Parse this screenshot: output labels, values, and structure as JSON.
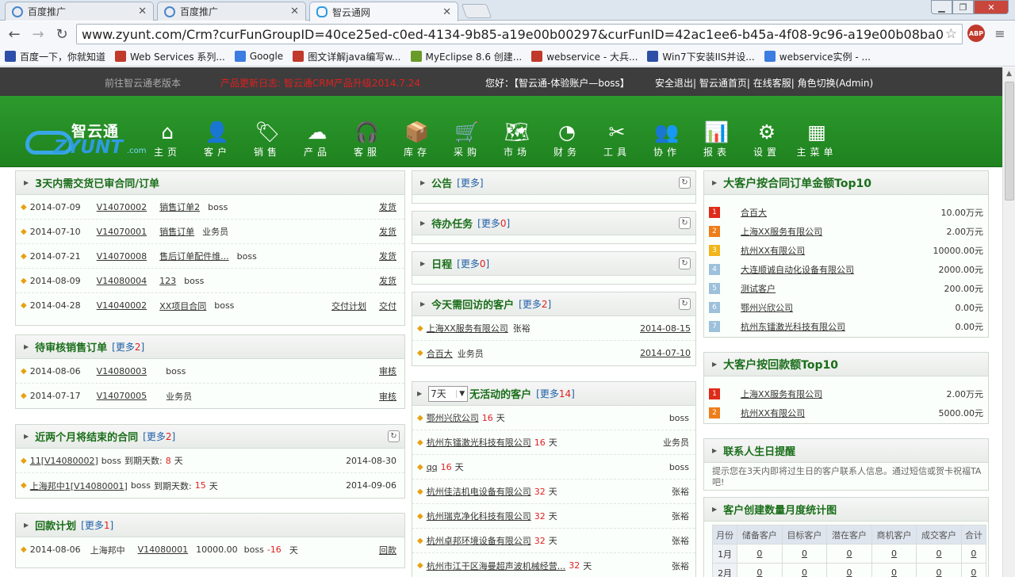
{
  "browser": {
    "tabs": [
      {
        "title": "百度推广",
        "active": false
      },
      {
        "title": "百度推广",
        "active": false
      },
      {
        "title": "智云通网",
        "active": true
      }
    ],
    "url": "www.zyunt.com/Crm?curFunGroupID=40ce25ed-c0ed-4134-9b85-a19e00b00297&curFunID=42ac1ee6-b45a-4f08-9c96-a19e00b08ba0",
    "abp_label": "ABP",
    "bookmarks": [
      {
        "label": "百度一下，你就知道",
        "color": "#2d4fa8"
      },
      {
        "label": "Web Services 系列...",
        "color": "#c0392b"
      },
      {
        "label": "Google",
        "color": "#3b7de0"
      },
      {
        "label": "图文详解java编写w...",
        "color": "#c0392b"
      },
      {
        "label": "MyEclipse 8.6 创建...",
        "color": "#6a9a2a"
      },
      {
        "label": "webservice - 大兵...",
        "color": "#c0392b"
      },
      {
        "label": "Win7下安装IIS并设...",
        "color": "#2d4fa8"
      },
      {
        "label": "webservice实例 - ...",
        "color": "#3b7de0"
      }
    ]
  },
  "topbar": {
    "old_version": "前往智云通老版本",
    "notice": "产品更新日志: 智云通CRM产品升级2014.7.24",
    "hello": "您好：【智云通-体验账户—boss】",
    "links": "安全退出| 智云通首页| 在线客服| 角色切换(Admin)"
  },
  "logo": {
    "zh": "智云通",
    "en": "ZYUNT",
    "com": ".com"
  },
  "menu": [
    {
      "icon": "⌂",
      "label": "主页"
    },
    {
      "icon": "👤",
      "label": "客户"
    },
    {
      "icon": "🏷",
      "label": "销售"
    },
    {
      "icon": "☁",
      "label": "产品"
    },
    {
      "icon": "🎧",
      "label": "客服"
    },
    {
      "icon": "📦",
      "label": "库存"
    },
    {
      "icon": "🛒",
      "label": "采购"
    },
    {
      "icon": "🗺",
      "label": "市场"
    },
    {
      "icon": "◔",
      "label": "财务"
    },
    {
      "icon": "✂",
      "label": "工具"
    },
    {
      "icon": "👥",
      "label": "协作"
    },
    {
      "icon": "📊",
      "label": "报表"
    },
    {
      "icon": "⚙",
      "label": "设置"
    },
    {
      "icon": "▦",
      "label": "主菜单"
    }
  ],
  "panels": {
    "deliver": {
      "title": "3天内需交货已审合同/订单",
      "rows": [
        {
          "date": "2014-07-09",
          "code": "V14070002",
          "name": "销售订单2",
          "user": "boss",
          "actions": [
            "发货"
          ]
        },
        {
          "date": "2014-07-10",
          "code": "V14070001",
          "name": "销售订单",
          "user": "业务员",
          "actions": [
            "发货"
          ]
        },
        {
          "date": "2014-07-21",
          "code": "V14070008",
          "name": "售后订单配件维...",
          "user": "boss",
          "actions": [
            "发货"
          ]
        },
        {
          "date": "2014-08-09",
          "code": "V14080004",
          "name": "123",
          "user": "boss",
          "actions": [
            "发货"
          ]
        },
        {
          "date": "2014-04-28",
          "code": "V14040002",
          "name": "XX项目合同",
          "user": "boss",
          "actions": [
            "交付计划",
            "交付"
          ]
        }
      ]
    },
    "audit": {
      "title": "待审核销售订单",
      "more": "更多",
      "count": "2",
      "rows": [
        {
          "date": "2014-08-06",
          "code": "V14080003",
          "user": "boss",
          "action": "审核"
        },
        {
          "date": "2014-07-17",
          "code": "V14070005",
          "user": "业务员",
          "action": "审核"
        }
      ]
    },
    "ending": {
      "title": "近两个月将结束的合同",
      "more": "更多",
      "count": "2",
      "days_label": "到期天数:",
      "days_unit": "天",
      "rows": [
        {
          "name": "11[V14080002]",
          "user": "boss",
          "days": "8",
          "date": "2014-08-30"
        },
        {
          "name": "上海邦中1[V14080001]",
          "user": "boss",
          "days": "15",
          "date": "2014-09-06"
        }
      ]
    },
    "payment": {
      "title": "回款计划",
      "more": "更多",
      "count": "1",
      "days_unit": "天",
      "rows": [
        {
          "date": "2014-08-06",
          "client": "上海邦中",
          "code": "V14080001",
          "amount": "10000.00",
          "user": "boss",
          "days": "-16",
          "action": "回款"
        }
      ]
    },
    "notice": {
      "title": "公告",
      "more": "更多"
    },
    "todo": {
      "title": "待办任务",
      "more": "更多",
      "count": "0"
    },
    "schedule": {
      "title": "日程",
      "more": "更多",
      "count": "0"
    },
    "visit": {
      "title": "今天需回访的客户",
      "more": "更多",
      "count": "2",
      "rows": [
        {
          "client": "上海XX服务有限公司",
          "user": "张裕",
          "date": "2014-08-15"
        },
        {
          "client": "合百大",
          "user": "业务员",
          "date": "2014-07-10"
        }
      ]
    },
    "inactive": {
      "select_value": "7天",
      "title": "无活动的客户",
      "more": "更多",
      "count": "14",
      "days_unit": "天",
      "rows": [
        {
          "client": "鄂州兴欣公司",
          "days": "16",
          "user": "boss"
        },
        {
          "client": "杭州东镭激光科技有限公司",
          "days": "16",
          "user": "业务员"
        },
        {
          "client": "qq",
          "days": "16",
          "user": "boss"
        },
        {
          "client": "杭州佳洁机电设备有限公司",
          "days": "32",
          "user": "张裕"
        },
        {
          "client": "杭州瑞克净化科技有限公司",
          "days": "32",
          "user": "张裕"
        },
        {
          "client": "杭州卓邦环境设备有限公司",
          "days": "32",
          "user": "张裕"
        },
        {
          "client": "杭州市江干区海曼超声波机械经营...",
          "days": "32",
          "user": "张裕"
        }
      ]
    },
    "top_contract": {
      "title": "大客户按合同订单金额Top10",
      "rows": [
        {
          "rank": "1",
          "color": "#e02a1a",
          "name": "合百大",
          "amount": "10.00万元"
        },
        {
          "rank": "2",
          "color": "#ef7d1a",
          "name": "上海XX服务有限公司",
          "amount": "2.00万元"
        },
        {
          "rank": "3",
          "color": "#f2b51a",
          "name": "杭州XX有限公司",
          "amount": "10000.00元"
        },
        {
          "rank": "4",
          "color": "#9dc0db",
          "name": "大连顺诚自动化设备有限公司",
          "amount": "2000.00元"
        },
        {
          "rank": "5",
          "color": "#9dc0db",
          "name": "测试客户",
          "amount": "200.00元"
        },
        {
          "rank": "6",
          "color": "#9dc0db",
          "name": "鄂州兴欣公司",
          "amount": "0.00元"
        },
        {
          "rank": "7",
          "color": "#9dc0db",
          "name": "杭州东镭激光科技有限公司",
          "amount": "0.00元"
        }
      ]
    },
    "top_payment": {
      "title": "大客户按回款额Top10",
      "rows": [
        {
          "rank": "1",
          "color": "#e02a1a",
          "name": "上海XX服务有限公司",
          "amount": "2.00万元"
        },
        {
          "rank": "2",
          "color": "#ef7d1a",
          "name": "杭州XX有限公司",
          "amount": "5000.00元"
        }
      ]
    },
    "birthday": {
      "title": "联系人生日提醒",
      "text": "提示您在3天内即将过生日的客户联系人信息。通过短信或贺卡祝福TA吧!"
    },
    "monthly": {
      "title": "客户创建数量月度统计图",
      "headers": [
        "月份",
        "储备客户",
        "目标客户",
        "潜在客户",
        "商机客户",
        "成交客户",
        "合计"
      ],
      "rows": [
        {
          "month": "1月",
          "values": [
            "0",
            "0",
            "0",
            "0",
            "0",
            "0"
          ]
        },
        {
          "month": "2月",
          "values": [
            "0",
            "0",
            "0",
            "0",
            "0",
            "0"
          ]
        }
      ]
    }
  }
}
